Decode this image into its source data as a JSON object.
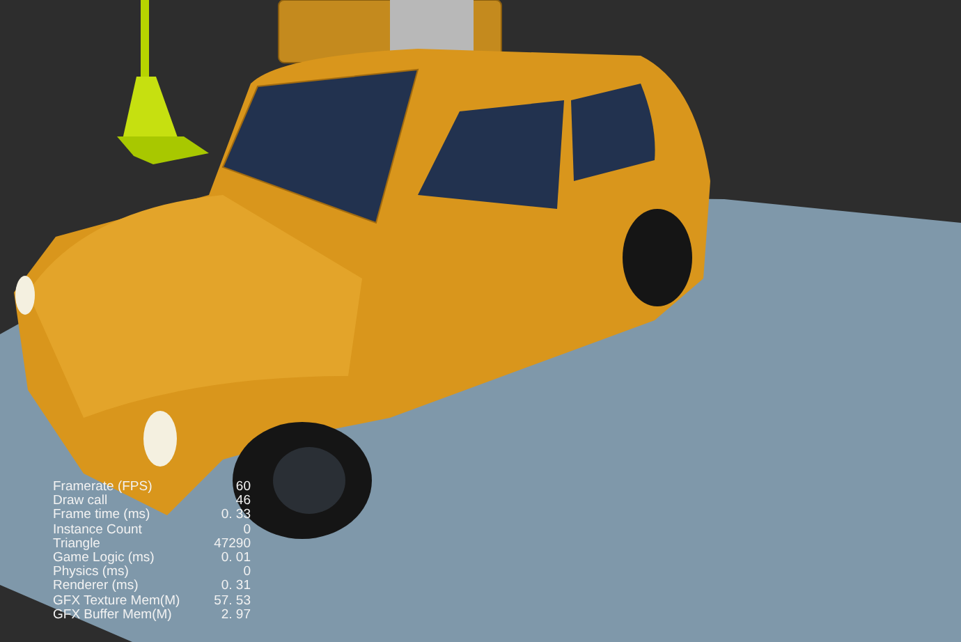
{
  "stats": [
    {
      "label": "Framerate (FPS)",
      "value": "60"
    },
    {
      "label": "Draw call",
      "value": "46"
    },
    {
      "label": "Frame time (ms)",
      "value": "0. 33"
    },
    {
      "label": "Instance Count",
      "value": "0"
    },
    {
      "label": "Triangle",
      "value": "47290"
    },
    {
      "label": "Game Logic (ms)",
      "value": "0. 01"
    },
    {
      "label": "Physics (ms)",
      "value": "0"
    },
    {
      "label": "Renderer (ms)",
      "value": "0. 31"
    },
    {
      "label": "GFX Texture Mem(M)",
      "value": "57. 53"
    },
    {
      "label": "GFX Buffer Mem(M)",
      "value": "2. 97"
    }
  ]
}
